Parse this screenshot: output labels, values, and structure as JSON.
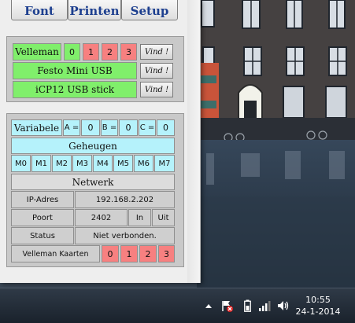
{
  "toolbar": {
    "font_label": "Font",
    "printen_label": "Printen",
    "setup_label": "Setup"
  },
  "devices": {
    "velleman_label": "Velleman",
    "velleman_channels": [
      "0",
      "1",
      "2",
      "3"
    ],
    "festo_label": "Festo Mini USB",
    "icp12_label": "iCP12 USB stick",
    "find_label": "Vind !"
  },
  "variables": {
    "title": "Variabele",
    "a_label": "A =",
    "a_value": "0",
    "b_label": "B =",
    "b_value": "0",
    "c_label": "C =",
    "c_value": "0"
  },
  "memory": {
    "title": "Geheugen",
    "cells": [
      "M0",
      "M1",
      "M2",
      "M3",
      "M4",
      "M5",
      "M6",
      "M7"
    ]
  },
  "network": {
    "title": "Netwerk",
    "ip_label": "IP-Adres",
    "ip_value": "192.168.2.202",
    "port_label": "Poort",
    "port_value": "2402",
    "in_label": "In",
    "out_label": "Uit",
    "status_label": "Status",
    "status_value": "Niet verbonden.",
    "cards_label": "Velleman Kaarten",
    "cards": [
      "0",
      "1",
      "2",
      "3"
    ]
  },
  "taskbar": {
    "time": "10:55",
    "date": "24-1-2014"
  },
  "colors": {
    "green": "#80ef6b",
    "red": "#f78080",
    "cyan": "#b5f2fb",
    "gray": "#cfcfcf"
  }
}
